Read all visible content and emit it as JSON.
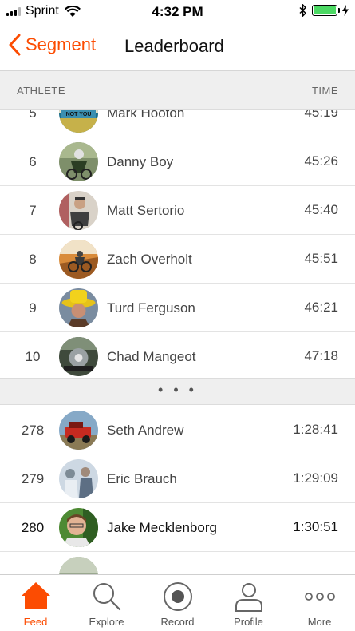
{
  "status": {
    "carrier": "Sprint",
    "time": "4:32 PM"
  },
  "nav": {
    "back_label": "Segment",
    "title": "Leaderboard"
  },
  "columns": {
    "athlete": "ATHLETE",
    "time": "TIME"
  },
  "rows": [
    {
      "rank": "5",
      "name": "Mark Hooton",
      "time": "45:19",
      "badge": "NOT YOU"
    },
    {
      "rank": "6",
      "name": "Danny Boy",
      "time": "45:26"
    },
    {
      "rank": "7",
      "name": "Matt Sertorio",
      "time": "45:40"
    },
    {
      "rank": "8",
      "name": "Zach Overholt",
      "time": "45:51"
    },
    {
      "rank": "9",
      "name": "Turd Ferguson",
      "time": "46:21"
    },
    {
      "rank": "10",
      "name": "Chad Mangeot",
      "time": "47:18"
    },
    {
      "rank": "278",
      "name": "Seth Andrew",
      "time": "1:28:41"
    },
    {
      "rank": "279",
      "name": "Eric Brauch",
      "time": "1:29:09"
    },
    {
      "rank": "280",
      "name": "Jake Mecklenborg",
      "time": "1:30:51"
    }
  ],
  "separator": "• • •",
  "tabs": [
    {
      "label": "Feed",
      "icon": "home-icon"
    },
    {
      "label": "Explore",
      "icon": "search-icon"
    },
    {
      "label": "Record",
      "icon": "record-icon"
    },
    {
      "label": "Profile",
      "icon": "profile-icon"
    },
    {
      "label": "More",
      "icon": "more-icon"
    }
  ],
  "colors": {
    "accent": "#fc4c02",
    "battery": "#4cd964"
  }
}
